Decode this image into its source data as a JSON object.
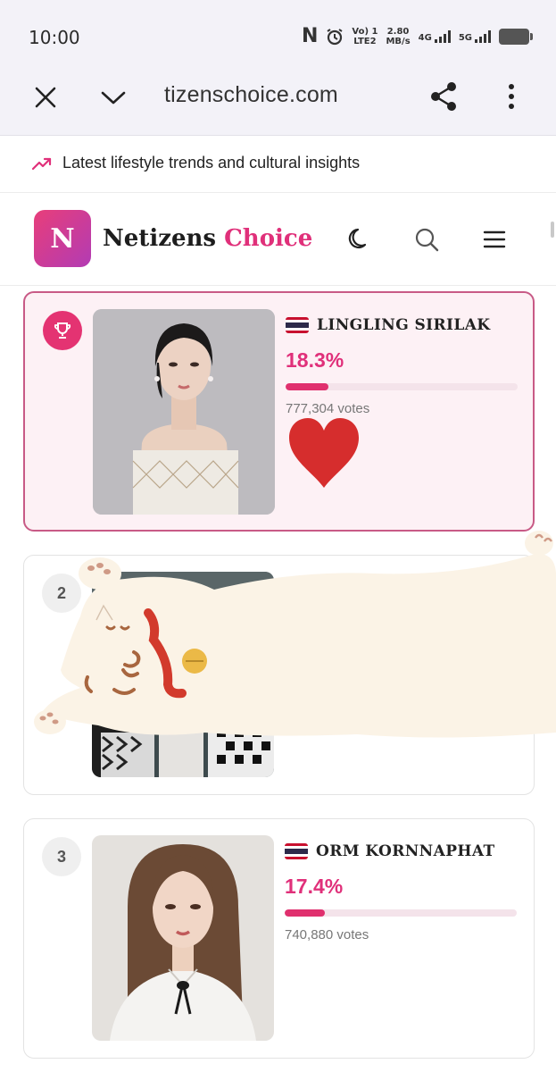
{
  "status": {
    "time": "10:00",
    "vol_top": "Vo) 1",
    "vol_bottom": "LTE2",
    "speed_top": "2.80",
    "speed_bottom": "MB/s",
    "net1": "4G",
    "net2": "5G"
  },
  "browser": {
    "url": "tizenschoice.com"
  },
  "announcement": {
    "text": "Latest lifestyle trends and cultural insights",
    "icon": "trending-up-icon"
  },
  "site": {
    "logo_letter": "N",
    "brand_main": "Netizens",
    "brand_accent": "Choice"
  },
  "colors": {
    "accent": "#e0307a",
    "bar_track": "#f4e3ea",
    "top_card_bg": "#fdf1f5",
    "top_card_border": "#c85a86"
  },
  "rankings": [
    {
      "rank": "1",
      "name": "LINGLING SIRILAK",
      "percent": "18.3%",
      "percent_value": 18.3,
      "votes": "777,304 votes"
    },
    {
      "rank": "2"
    },
    {
      "rank": "3",
      "name": "ORM KORNNAPHAT",
      "percent": "17.4%",
      "percent_value": 17.4,
      "votes": "740,880 votes"
    }
  ]
}
